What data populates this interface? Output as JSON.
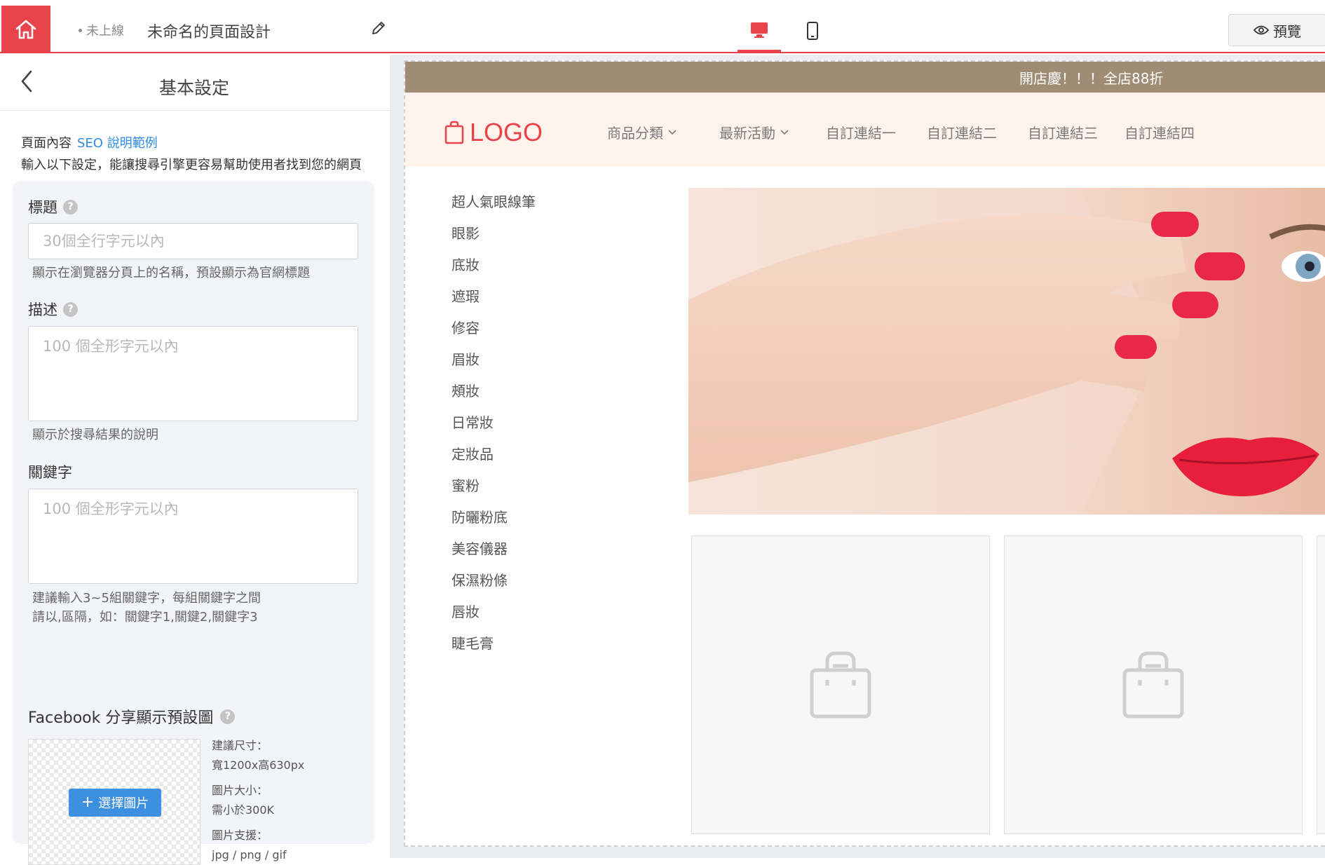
{
  "topbar": {
    "status": "未上線",
    "page_name": "未命名的頁面設計",
    "preview_label": "預覽",
    "accent": "#e8434b"
  },
  "panel": {
    "title": "基本設定",
    "seo_prefix": "頁面內容",
    "seo_link": "SEO 說明範例",
    "seo_desc": "輸入以下設定，能讓搜尋引擎更容易幫助使用者找到您的網頁",
    "title_field": {
      "label": "標題",
      "placeholder": "30個全行字元以內",
      "hint": "顯示在瀏覽器分頁上的名稱，預設顯示為官網標題"
    },
    "desc_field": {
      "label": "描述",
      "placeholder": "100 個全形字元以內",
      "hint": "顯示於搜尋結果的說明"
    },
    "keyword_field": {
      "label": "關鍵字",
      "placeholder": "100 個全形字元以內",
      "hint_line1": "建議輸入3~5組關鍵字，每組關鍵字之間",
      "hint_line2": "請以,區隔，如：關鍵字1,關鍵2,關鍵字3"
    },
    "facebook": {
      "label": "Facebook 分享顯示預設圖",
      "choose_button": "選擇圖片",
      "size_label": "建議尺寸：",
      "size_value": "寬1200x高630px",
      "filesize_label": "圖片大小：",
      "filesize_value": "需小於300K",
      "format_label": "圖片支援：",
      "format_value": "jpg / png / gif"
    }
  },
  "site": {
    "announcement": "開店慶！！！全店88折",
    "logo": "LOGO",
    "nav": [
      {
        "label": "商品分類",
        "dropdown": true
      },
      {
        "label": "最新活動",
        "dropdown": true
      },
      {
        "label": "自訂連結一",
        "dropdown": false
      },
      {
        "label": "自訂連結二",
        "dropdown": false
      },
      {
        "label": "自訂連結三",
        "dropdown": false
      },
      {
        "label": "自訂連結四",
        "dropdown": false
      }
    ],
    "categories": [
      "超人氣眼線筆",
      "眼影",
      "底妝",
      "遮瑕",
      "修容",
      "眉妝",
      "頰妝",
      "日常妝",
      "定妝品",
      "蜜粉",
      "防曬粉底",
      "美容儀器",
      "保濕粉條",
      "唇妝",
      "睫毛膏"
    ],
    "announce_color": "#a08b74",
    "header_bg": "#fff3ec"
  }
}
